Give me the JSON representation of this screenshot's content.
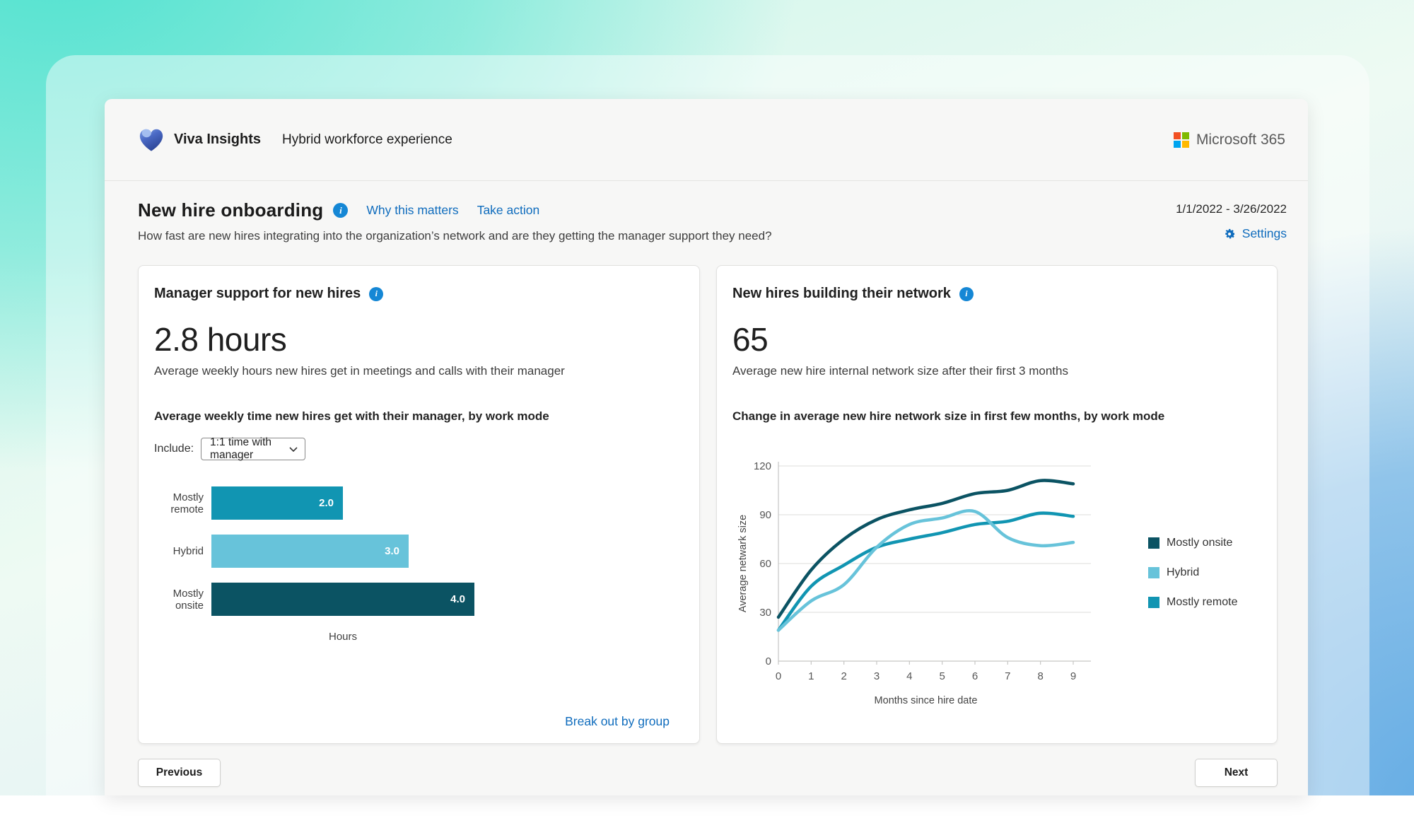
{
  "app": {
    "brand": "Viva Insights",
    "product": "Hybrid workforce experience",
    "ms_brand": "Microsoft 365"
  },
  "icons": {
    "info": "i"
  },
  "page": {
    "title": "New hire onboarding",
    "why_link": "Why this matters",
    "action_link": "Take action",
    "date_range": "1/1/2022 - 3/26/2022",
    "subtitle": "How fast are new hires integrating into the organization’s network and are they getting the manager support they need?",
    "settings_label": "Settings",
    "breakout_link": "Break out by group",
    "previous_label": "Previous",
    "next_label": "Next"
  },
  "cards": {
    "manager_support": {
      "title": "Manager support for new hires",
      "kpi": "2.8 hours",
      "kpi_desc": "Average weekly hours new hires get in meetings and calls with their manager",
      "include_label": "Include:",
      "dropdown_value": "1:1 time with manager"
    },
    "network": {
      "title": "New hires building their network",
      "kpi": "65",
      "kpi_desc": "Average new hire internal network size after their first 3 months"
    }
  },
  "chart_data": [
    {
      "type": "bar",
      "orientation": "horizontal",
      "title": "Average weekly time new hires get with their manager, by work mode",
      "categories": [
        "Mostly remote",
        "Hybrid",
        "Mostly onsite"
      ],
      "values": [
        2.0,
        3.0,
        4.0
      ],
      "value_labels": [
        "2.0",
        "3.0",
        "4.0"
      ],
      "colors": [
        "#1195b2",
        "#67c3da",
        "#0b5363"
      ],
      "xlabel": "Hours",
      "xlim": [
        0,
        4
      ]
    },
    {
      "type": "line",
      "title": "Change in average new hire network size in first few months, by work mode",
      "x": [
        0,
        1,
        2,
        3,
        4,
        5,
        6,
        7,
        8,
        9
      ],
      "series": [
        {
          "name": "Mostly onsite",
          "color": "#0b5363",
          "values": [
            27,
            56,
            75,
            87,
            93,
            97,
            103,
            105,
            111,
            109
          ]
        },
        {
          "name": "Hybrid",
          "color": "#67c3da",
          "values": [
            19,
            37,
            47,
            70,
            84,
            88,
            92,
            76,
            71,
            73
          ]
        },
        {
          "name": "Mostly remote",
          "color": "#1195b2",
          "values": [
            19,
            46,
            59,
            70,
            75,
            79,
            84,
            86,
            91,
            89
          ]
        }
      ],
      "xlabel": "Months since hire date",
      "ylabel": "Average netwark size",
      "ylim": [
        0,
        120
      ],
      "yticks": [
        0,
        30,
        60,
        90,
        120
      ],
      "legend_position": "right",
      "grid": "horizontal"
    }
  ],
  "colors": {
    "link": "#0f6cbd",
    "info": "#1587d5",
    "onsite": "#0b5363",
    "hybrid": "#67c3da",
    "remote": "#1195b2",
    "ms_squares": [
      "#f25022",
      "#7fba00",
      "#00a4ef",
      "#ffb900"
    ]
  }
}
